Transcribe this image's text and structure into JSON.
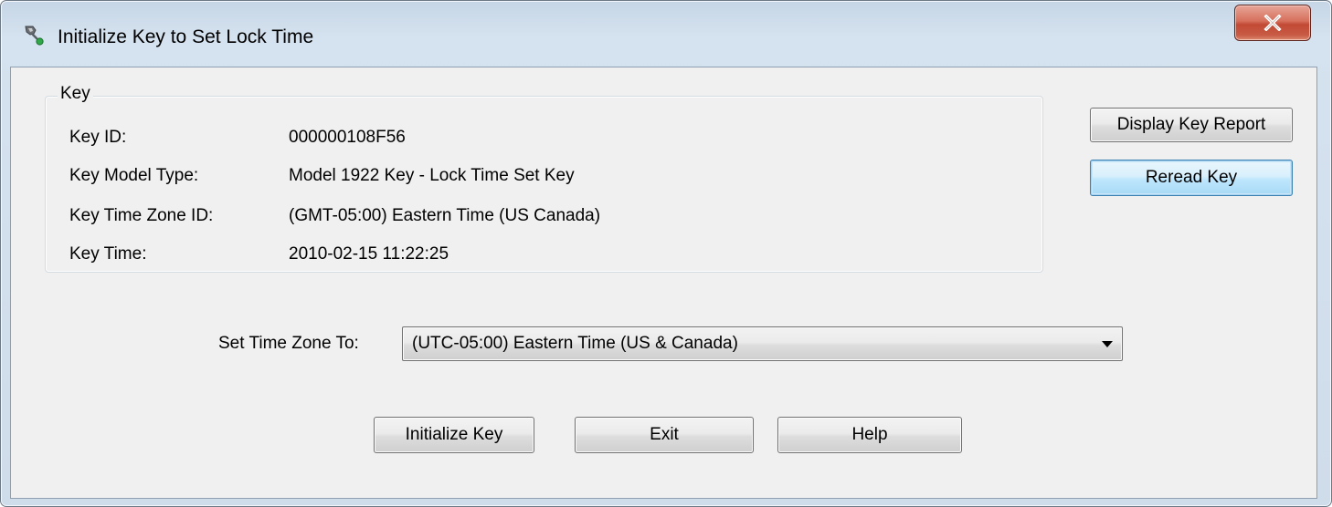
{
  "window": {
    "title": "Initialize Key to Set Lock Time",
    "icon": "key-app-icon",
    "close_icon": "close-x-icon"
  },
  "key_group": {
    "legend": "Key",
    "rows": [
      {
        "label": "Key ID:",
        "value": "000000108F56"
      },
      {
        "label": "Key Model Type:",
        "value": "Model 1922 Key - Lock Time Set Key"
      },
      {
        "label": "Key Time Zone ID:",
        "value": "(GMT-05:00) Eastern Time (US  Canada)"
      },
      {
        "label": "Key Time:",
        "value": "2010-02-15 11:22:25"
      }
    ]
  },
  "side_buttons": {
    "display_report": "Display Key Report",
    "reread": "Reread Key"
  },
  "time_zone": {
    "label": "Set Time Zone To:",
    "selected": "(UTC-05:00) Eastern Time (US & Canada)"
  },
  "bottom_buttons": {
    "initialize": "Initialize Key",
    "exit": "Exit",
    "help": "Help"
  },
  "colors": {
    "close_button": "#c85a44",
    "default_button_border": "#3c7fb1",
    "client_background": "#f0f0f0"
  }
}
